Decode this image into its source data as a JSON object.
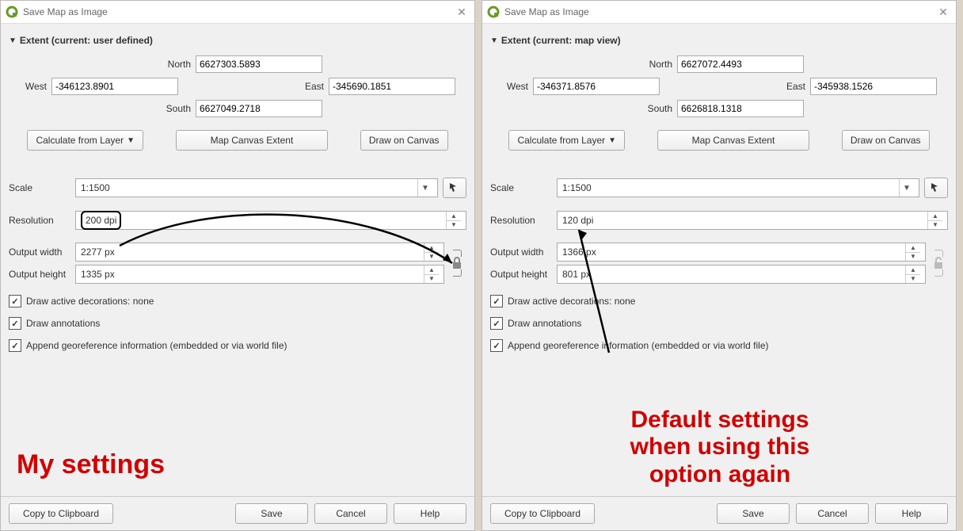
{
  "left": {
    "title": "Save Map as Image",
    "extent_header": "Extent (current: user defined)",
    "north": "6627303.5893",
    "south": "6627049.2718",
    "west": "-346123.8901",
    "east": "-345690.1851",
    "label_north": "North",
    "label_south": "South",
    "label_west": "West",
    "label_east": "East",
    "btn_calc": "Calculate from Layer",
    "btn_canvas": "Map Canvas Extent",
    "btn_draw": "Draw on Canvas",
    "label_scale": "Scale",
    "scale": "1:1500",
    "label_resolution": "Resolution",
    "resolution": "200 dpi",
    "label_width": "Output width",
    "width": "2277 px",
    "label_height": "Output height",
    "height": "1335 px",
    "chk_decor": "Draw active decorations: none",
    "chk_annot": "Draw annotations",
    "chk_georef": "Append georeference information (embedded or via world file)",
    "btn_copy": "Copy to Clipboard",
    "btn_save": "Save",
    "btn_cancel": "Cancel",
    "btn_help": "Help",
    "caption": "My settings"
  },
  "right": {
    "title": "Save Map as Image",
    "extent_header": "Extent (current: map view)",
    "north": "6627072.4493",
    "south": "6626818.1318",
    "west": "-346371.8576",
    "east": "-345938.1526",
    "label_north": "North",
    "label_south": "South",
    "label_west": "West",
    "label_east": "East",
    "btn_calc": "Calculate from Layer",
    "btn_canvas": "Map Canvas Extent",
    "btn_draw": "Draw on Canvas",
    "label_scale": "Scale",
    "scale": "1:1500",
    "label_resolution": "Resolution",
    "resolution": "120 dpi",
    "label_width": "Output width",
    "width": "1366 px",
    "label_height": "Output height",
    "height": "801 px",
    "chk_decor": "Draw active decorations: none",
    "chk_annot": "Draw annotations",
    "chk_georef": "Append georeference information (embedded or via world file)",
    "btn_copy": "Copy to Clipboard",
    "btn_save": "Save",
    "btn_cancel": "Cancel",
    "btn_help": "Help",
    "caption": "Default settings\nwhen using this\noption again"
  }
}
